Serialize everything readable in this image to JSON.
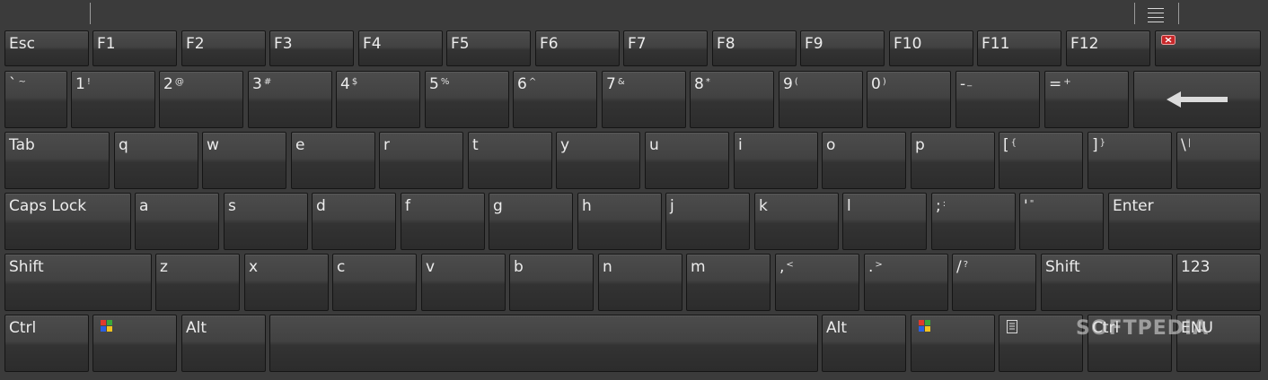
{
  "window": {
    "title": ""
  },
  "colors": {
    "background": "#3b3b3b",
    "key_border": "#151515",
    "close_red": "#c8282a"
  },
  "keys": {
    "esc": "Esc",
    "f1": "F1",
    "f2": "F2",
    "f3": "F3",
    "f4": "F4",
    "f5": "F5",
    "f6": "F6",
    "f7": "F7",
    "f8": "F8",
    "f9": "F9",
    "f10": "F10",
    "f11": "F11",
    "f12": "F12",
    "backtick": "`",
    "backtick_sub": "~",
    "n1": "1",
    "n1_sub": "!",
    "n2": "2",
    "n2_sub": "@",
    "n3": "3",
    "n3_sub": "#",
    "n4": "4",
    "n4_sub": "$",
    "n5": "5",
    "n5_sub": "%",
    "n6": "6",
    "n6_sub": "^",
    "n7": "7",
    "n7_sub": "&",
    "n8": "8",
    "n8_sub": "*",
    "n9": "9",
    "n9_sub": "(",
    "n0": "0",
    "n0_sub": ")",
    "minus": "-",
    "minus_sub": "_",
    "equals": "=",
    "equals_sub": "+",
    "tab": "Tab",
    "q": "q",
    "w": "w",
    "e": "e",
    "r": "r",
    "t": "t",
    "y": "y",
    "u": "u",
    "i": "i",
    "o": "o",
    "p": "p",
    "lbracket": "[",
    "lbracket_sub": "{",
    "rbracket": "]",
    "rbracket_sub": "}",
    "backslash": "\\",
    "backslash_sub": "|",
    "capslock": "Caps Lock",
    "a": "a",
    "s": "s",
    "d": "d",
    "f": "f",
    "g": "g",
    "h": "h",
    "j": "j",
    "k": "k",
    "l": "l",
    "semicolon": ";",
    "semicolon_sub": ":",
    "quote": "'",
    "quote_sub": "\"",
    "enter": "Enter",
    "shift_left": "Shift",
    "z": "z",
    "x": "x",
    "c": "c",
    "v": "v",
    "b": "b",
    "n": "n",
    "m": "m",
    "comma": ",",
    "comma_sub": "<",
    "period": ".",
    "period_sub": ">",
    "slash": "/",
    "slash_sub": "?",
    "shift_right": "Shift",
    "numpad_toggle": "123",
    "ctrl_left": "Ctrl",
    "alt_left": "Alt",
    "space": "",
    "alt_right": "Alt",
    "ctrl_right": "Ctrl",
    "lang": "ENU"
  },
  "watermark": "SOFTPEDIA"
}
